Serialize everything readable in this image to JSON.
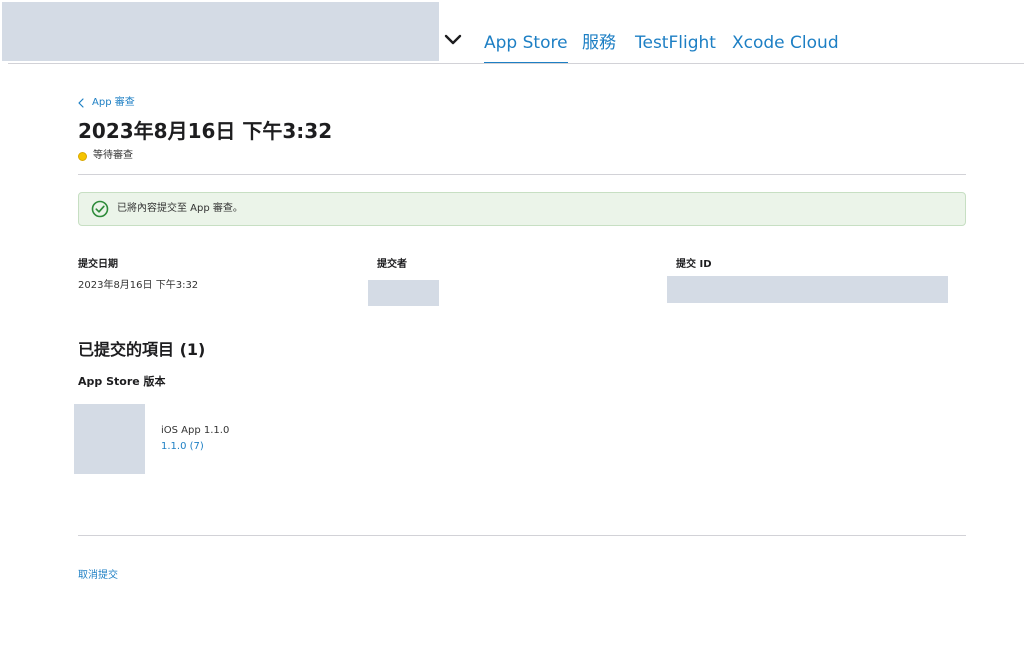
{
  "header": {
    "tabs": [
      {
        "label": "App Store",
        "active": true
      },
      {
        "label": "服務",
        "active": false
      },
      {
        "label": "TestFlight",
        "active": false
      },
      {
        "label": "Xcode Cloud",
        "active": false
      }
    ]
  },
  "breadcrumb": {
    "back_label": "App 審查"
  },
  "submission": {
    "title": "2023年8月16日 下午3:32",
    "status": "等待審查"
  },
  "banner": {
    "message": "已將內容提交至 App 審查。"
  },
  "meta": {
    "submitted_date_label": "提交日期",
    "submitted_date_value": "2023年8月16日 下午3:32",
    "submitter_label": "提交者",
    "submission_id_label": "提交 ID"
  },
  "items": {
    "heading": "已提交的項目 (1)",
    "version_heading": "App Store 版本",
    "app_name": "iOS App 1.1.0",
    "build": "1.1.0 (7)"
  },
  "actions": {
    "cancel_label": "取消提交"
  },
  "colors": {
    "accent": "#1d7fc4",
    "status_pending": "#f5c400",
    "success_icon": "#2e8b3a",
    "banner_bg": "#ebf4e9"
  }
}
